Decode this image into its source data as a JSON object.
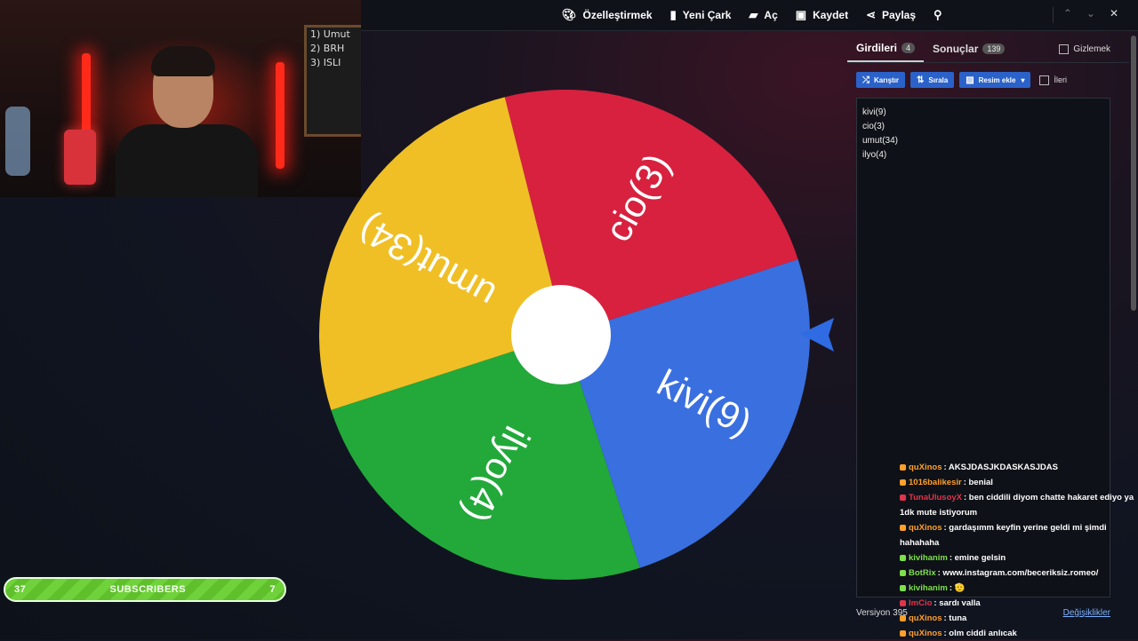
{
  "toolbar": {
    "items": [
      {
        "icon": "palette-icon",
        "label": "Özelleştirmek"
      },
      {
        "icon": "file-icon",
        "label": "Yeni Çark"
      },
      {
        "icon": "folder-open-icon",
        "label": "Aç"
      },
      {
        "icon": "save-icon",
        "label": "Kaydet"
      },
      {
        "icon": "share-icon",
        "label": "Paylaş"
      }
    ]
  },
  "wheel": {
    "segments": [
      {
        "label": "cio(3)",
        "color": "#d7213f"
      },
      {
        "label": "kivi(9)",
        "color": "#3a6fe0"
      },
      {
        "label": "ilyo(4)",
        "color": "#22a93a"
      },
      {
        "label": "umut(34)",
        "color": "#f0bf26"
      }
    ],
    "pointer_color": "#2f6be2"
  },
  "panel": {
    "tab_entries": {
      "label": "Girdileri",
      "count": "4"
    },
    "tab_results": {
      "label": "Sonuçlar",
      "count": "139"
    },
    "hide_label": "Gizlemek",
    "shuffle_label": "Karıştır",
    "sort_label": "Sırala",
    "add_image_label": "Resim ekle",
    "advanced_label": "İleri",
    "entries": [
      "kivi(9)",
      "cio(3)",
      "umut(34)",
      "ilyo(4)"
    ],
    "version": "Versiyon 395",
    "changelog": "Değişiklikler"
  },
  "chat": {
    "messages": [
      {
        "user": "quXinos",
        "color": "#ff9f2a",
        "text": "AKSJDASJKDASKASJDAS"
      },
      {
        "user": "1016balikesir",
        "color": "#ff9f2a",
        "text": "benial"
      },
      {
        "user": "TunaUlusoyX",
        "color": "#e0344c",
        "text": "ben ciddili diyom chatte hakaret ediyo ya 1dk mute istiyorum"
      },
      {
        "user": "quXinos",
        "color": "#ff9f2a",
        "text": "gardaşımm keyfin yerine geldi mi şimdi hahahaha"
      },
      {
        "user": "kivihanim",
        "color": "#7ee04a",
        "text": "emine gelsin"
      },
      {
        "user": "BotRix",
        "color": "#7ee04a",
        "text": "www.instagram.com/beceriksiz.romeo/"
      },
      {
        "user": "kivihanim",
        "color": "#7ee04a",
        "text": "🫡"
      },
      {
        "user": "ImCio",
        "color": "#e0344c",
        "text": "sardı valla"
      },
      {
        "user": "quXinos",
        "color": "#ff9f2a",
        "text": "tuna"
      },
      {
        "user": "quXinos",
        "color": "#ff9f2a",
        "text": "olm ciddi anlıcak"
      }
    ]
  },
  "subs": {
    "left": "37",
    "label": "SUBSCRIBERS",
    "right": "7"
  },
  "webcam": {
    "board_lines": [
      "1) Umut",
      "2) BRH",
      "3) ISLI"
    ]
  }
}
